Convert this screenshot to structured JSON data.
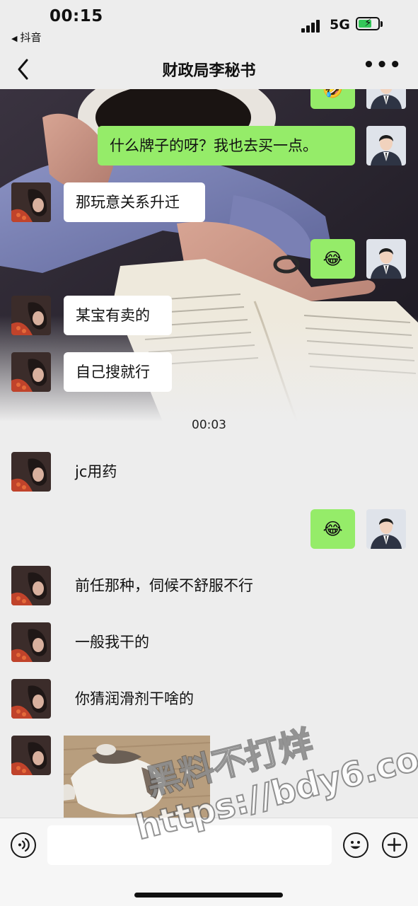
{
  "status_bar": {
    "time": "00:15",
    "back_app": "抖音",
    "network": "5G",
    "battery_icon": "battery-charging-icon"
  },
  "nav": {
    "title": "财政局李秘书",
    "back_icon": "chevron-left-icon",
    "more_label": "•••"
  },
  "messages": [
    {
      "side": "right",
      "type": "emoji",
      "text": "🤣"
    },
    {
      "side": "right",
      "type": "text",
      "text": "什么牌子的呀？我也去买一点。"
    },
    {
      "side": "left",
      "type": "text",
      "text": "那玩意关系升迁"
    },
    {
      "side": "right",
      "type": "emoji",
      "text": "😂"
    },
    {
      "side": "left",
      "type": "text",
      "text": "某宝有卖的"
    },
    {
      "side": "left",
      "type": "text",
      "text": "自己搜就行"
    },
    {
      "type": "timestamp",
      "text": "00:03"
    },
    {
      "side": "left",
      "type": "text",
      "text": "jc用药"
    },
    {
      "side": "right",
      "type": "emoji",
      "text": "😂"
    },
    {
      "side": "left",
      "type": "text",
      "text": "前任那种，伺候不舒服不行"
    },
    {
      "side": "left",
      "type": "text",
      "text": "一般我干的"
    },
    {
      "side": "left",
      "type": "text",
      "text": "你猜润滑剂干啥的"
    },
    {
      "side": "left",
      "type": "image",
      "text": "cat-photo"
    }
  ],
  "watermark": {
    "line1": "黑料不打烊",
    "line2": "https://bdy6.co"
  },
  "input_bar": {
    "placeholder": "",
    "voice_icon": "voice-icon",
    "emoji_icon": "smiley-icon",
    "plus_icon": "plus-icon"
  },
  "colors": {
    "background": "#ededed",
    "sent_bubble": "#95ec69",
    "received_bubble": "#ffffff",
    "battery": "#34c759"
  }
}
